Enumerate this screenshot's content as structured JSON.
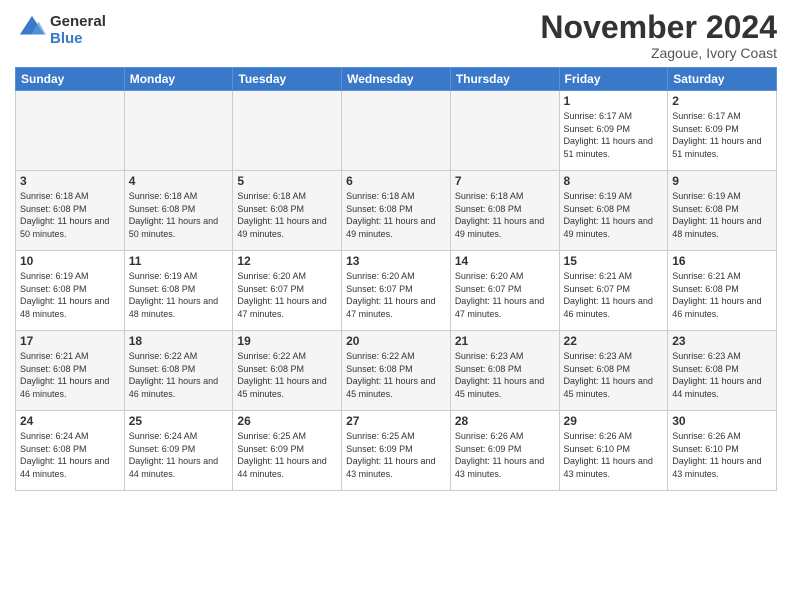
{
  "header": {
    "logo_general": "General",
    "logo_blue": "Blue",
    "month_title": "November 2024",
    "location": "Zagoue, Ivory Coast"
  },
  "days_of_week": [
    "Sunday",
    "Monday",
    "Tuesday",
    "Wednesday",
    "Thursday",
    "Friday",
    "Saturday"
  ],
  "weeks": [
    [
      {
        "day": "",
        "empty": true
      },
      {
        "day": "",
        "empty": true
      },
      {
        "day": "",
        "empty": true
      },
      {
        "day": "",
        "empty": true
      },
      {
        "day": "",
        "empty": true
      },
      {
        "day": "1",
        "sunrise": "6:17 AM",
        "sunset": "6:09 PM",
        "daylight": "11 hours and 51 minutes."
      },
      {
        "day": "2",
        "sunrise": "6:17 AM",
        "sunset": "6:09 PM",
        "daylight": "11 hours and 51 minutes."
      }
    ],
    [
      {
        "day": "3",
        "sunrise": "6:18 AM",
        "sunset": "6:08 PM",
        "daylight": "11 hours and 50 minutes."
      },
      {
        "day": "4",
        "sunrise": "6:18 AM",
        "sunset": "6:08 PM",
        "daylight": "11 hours and 50 minutes."
      },
      {
        "day": "5",
        "sunrise": "6:18 AM",
        "sunset": "6:08 PM",
        "daylight": "11 hours and 49 minutes."
      },
      {
        "day": "6",
        "sunrise": "6:18 AM",
        "sunset": "6:08 PM",
        "daylight": "11 hours and 49 minutes."
      },
      {
        "day": "7",
        "sunrise": "6:18 AM",
        "sunset": "6:08 PM",
        "daylight": "11 hours and 49 minutes."
      },
      {
        "day": "8",
        "sunrise": "6:19 AM",
        "sunset": "6:08 PM",
        "daylight": "11 hours and 49 minutes."
      },
      {
        "day": "9",
        "sunrise": "6:19 AM",
        "sunset": "6:08 PM",
        "daylight": "11 hours and 48 minutes."
      }
    ],
    [
      {
        "day": "10",
        "sunrise": "6:19 AM",
        "sunset": "6:08 PM",
        "daylight": "11 hours and 48 minutes."
      },
      {
        "day": "11",
        "sunrise": "6:19 AM",
        "sunset": "6:08 PM",
        "daylight": "11 hours and 48 minutes."
      },
      {
        "day": "12",
        "sunrise": "6:20 AM",
        "sunset": "6:07 PM",
        "daylight": "11 hours and 47 minutes."
      },
      {
        "day": "13",
        "sunrise": "6:20 AM",
        "sunset": "6:07 PM",
        "daylight": "11 hours and 47 minutes."
      },
      {
        "day": "14",
        "sunrise": "6:20 AM",
        "sunset": "6:07 PM",
        "daylight": "11 hours and 47 minutes."
      },
      {
        "day": "15",
        "sunrise": "6:21 AM",
        "sunset": "6:07 PM",
        "daylight": "11 hours and 46 minutes."
      },
      {
        "day": "16",
        "sunrise": "6:21 AM",
        "sunset": "6:08 PM",
        "daylight": "11 hours and 46 minutes."
      }
    ],
    [
      {
        "day": "17",
        "sunrise": "6:21 AM",
        "sunset": "6:08 PM",
        "daylight": "11 hours and 46 minutes."
      },
      {
        "day": "18",
        "sunrise": "6:22 AM",
        "sunset": "6:08 PM",
        "daylight": "11 hours and 46 minutes."
      },
      {
        "day": "19",
        "sunrise": "6:22 AM",
        "sunset": "6:08 PM",
        "daylight": "11 hours and 45 minutes."
      },
      {
        "day": "20",
        "sunrise": "6:22 AM",
        "sunset": "6:08 PM",
        "daylight": "11 hours and 45 minutes."
      },
      {
        "day": "21",
        "sunrise": "6:23 AM",
        "sunset": "6:08 PM",
        "daylight": "11 hours and 45 minutes."
      },
      {
        "day": "22",
        "sunrise": "6:23 AM",
        "sunset": "6:08 PM",
        "daylight": "11 hours and 45 minutes."
      },
      {
        "day": "23",
        "sunrise": "6:23 AM",
        "sunset": "6:08 PM",
        "daylight": "11 hours and 44 minutes."
      }
    ],
    [
      {
        "day": "24",
        "sunrise": "6:24 AM",
        "sunset": "6:08 PM",
        "daylight": "11 hours and 44 minutes."
      },
      {
        "day": "25",
        "sunrise": "6:24 AM",
        "sunset": "6:09 PM",
        "daylight": "11 hours and 44 minutes."
      },
      {
        "day": "26",
        "sunrise": "6:25 AM",
        "sunset": "6:09 PM",
        "daylight": "11 hours and 44 minutes."
      },
      {
        "day": "27",
        "sunrise": "6:25 AM",
        "sunset": "6:09 PM",
        "daylight": "11 hours and 43 minutes."
      },
      {
        "day": "28",
        "sunrise": "6:26 AM",
        "sunset": "6:09 PM",
        "daylight": "11 hours and 43 minutes."
      },
      {
        "day": "29",
        "sunrise": "6:26 AM",
        "sunset": "6:10 PM",
        "daylight": "11 hours and 43 minutes."
      },
      {
        "day": "30",
        "sunrise": "6:26 AM",
        "sunset": "6:10 PM",
        "daylight": "11 hours and 43 minutes."
      }
    ]
  ]
}
